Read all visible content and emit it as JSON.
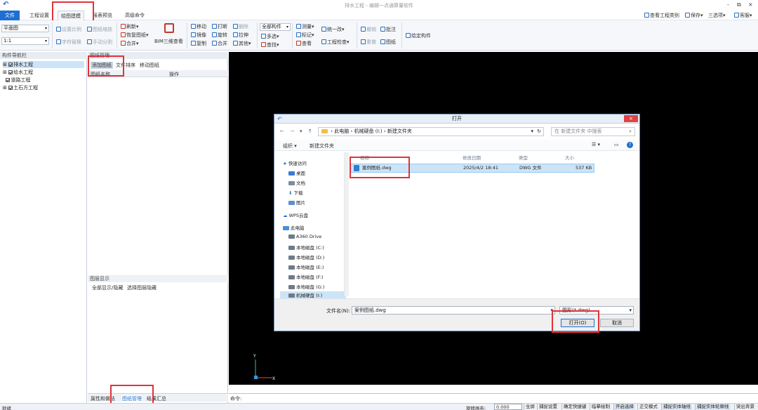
{
  "window": {
    "title": "排水工程 - 编辑一点通算量软件",
    "min": "-",
    "restore": "⧉",
    "close": "×"
  },
  "menubar": {
    "tabs": [
      "文件",
      "工程设置",
      "绘图建模",
      "报表预览",
      "高级命令"
    ],
    "right": [
      "查看工程类别",
      "保存",
      "三选项",
      "客服"
    ]
  },
  "ribbon": {
    "view_select": "平面图",
    "scale_select": "1:1",
    "drawing_btns": [
      "设置比例",
      "图纸缩放",
      "手动分割",
      "字符替换"
    ],
    "dr_col1": [
      "刷新",
      "恢复图纸",
      "合并"
    ],
    "bim_label": "BIM三维查看",
    "edit_col1": [
      "移动",
      "镜像",
      "复制"
    ],
    "edit_col2": [
      "打断",
      "旋转",
      "合并"
    ],
    "edit_col3": [
      "删除",
      "拉伸",
      "其他"
    ],
    "sel_col": [
      "全部构件",
      "多选",
      "查找"
    ],
    "meas_col": [
      "测量",
      "标记",
      "查看"
    ],
    "tool_col": [
      "统一改",
      "工程检查"
    ],
    "misc": [
      "撤销",
      "批注",
      "重做",
      "图纸"
    ],
    "axis_btn": "绘定构件"
  },
  "left_panel": {
    "header": "构件导航栏",
    "tree": [
      "排水工程",
      "给水工程",
      "道路工程",
      "土石方工程"
    ]
  },
  "mid_panel": {
    "header": "图纸管理",
    "toolbar": [
      "添加图纸",
      "文件排序",
      "移动图纸"
    ],
    "cols": [
      "图纸名称",
      "操作"
    ],
    "layer_header": "图层显示",
    "layer_opts": [
      "全部显示/隐藏",
      "选择图层隐藏"
    ],
    "bottom_tabs": [
      "属性和做法",
      "图纸管理",
      "结果汇总"
    ]
  },
  "canvas": {
    "axis_y": "Y",
    "axis_x": "X"
  },
  "cmdbar": {
    "label": "命令:"
  },
  "statusbar": {
    "left": "就绪",
    "rotate_label": "旋转画布:",
    "rotate_value": "0.000",
    "toggles": [
      "全屏",
      "捕捉设置",
      "确定快捷键",
      "临摹绘制",
      "开启选择",
      "正交模式",
      "捕捉实体轴线",
      "捕捉实体轮廓线",
      "突出背景"
    ]
  },
  "dialog": {
    "title": "打开",
    "path": [
      "此电脑",
      "机械硬盘 (I:)",
      "新建文件夹"
    ],
    "search_placeholder": "在 新建文件夹 中搜索",
    "toolbar": [
      "组织",
      "新建文件夹"
    ],
    "nav": [
      "快速访问",
      "桌面",
      "文档",
      "下载",
      "图片",
      "WPS云盘",
      "此电脑",
      "A360 Drive",
      "本地磁盘 (C:)",
      "本地磁盘 (D:)",
      "本地磁盘 (E:)",
      "本地磁盘 (F:)",
      "本地磁盘 (G:)",
      "机械硬盘 (I:)"
    ],
    "cols": [
      "名称",
      "修改日期",
      "类型",
      "大小"
    ],
    "file": {
      "name": "案例图纸.dwg",
      "date": "2025/4/2 18:41",
      "type": "DWG 文件",
      "size": "537 KB"
    },
    "filename_label": "文件名(N):",
    "filename_value": "案例图纸.dwg",
    "filter": "图形(*.dwg)",
    "open_btn": "打开(O)",
    "cancel_btn": "取消"
  }
}
